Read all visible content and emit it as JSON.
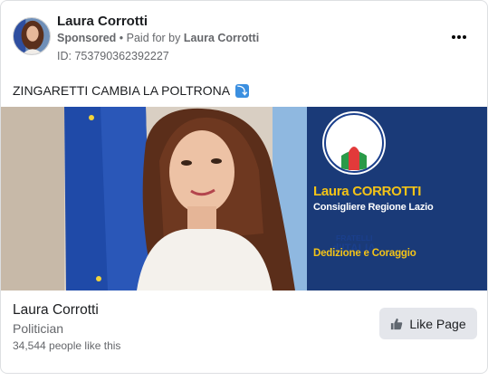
{
  "ad": {
    "page_name": "Laura Corrotti",
    "sponsored": "Sponsored",
    "separator": " • ",
    "paid_for_by_prefix": "Paid for by ",
    "paid_for_by": "Laura Corrotti",
    "ad_id": "ID: 753790362392227",
    "post_text": "ZINGARETTI CAMBIA LA POLTRONA",
    "post_emoji": "⤵"
  },
  "banner": {
    "logo_line1": "FRATELLI",
    "logo_line2": "d'ITALIA",
    "name": "Laura CORROTTI",
    "role": "Consigliere Regione Lazio",
    "slogan": "Dedizione e Coraggio"
  },
  "footer": {
    "page_name": "Laura Corrotti",
    "category": "Politician",
    "likes": "34,544 people like this",
    "like_button": "Like Page"
  },
  "colors": {
    "banner_blue": "#1a3a78",
    "accent_yellow": "#f3c318",
    "button_bg": "#e4e6eb"
  }
}
